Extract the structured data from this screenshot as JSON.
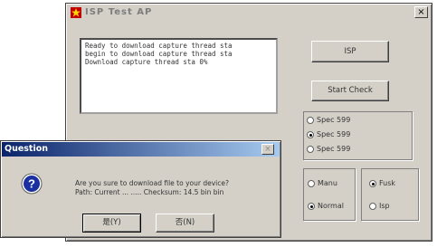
{
  "main_window": {
    "title": "ISP Test AP",
    "close_glyph": "×",
    "log_lines": [
      "Ready to download capture thread sta",
      "begin to download capture thread sta",
      "Download capture thread sta 0%"
    ],
    "buttons": {
      "top": "ISP",
      "second": "Start Check"
    },
    "spec_group": {
      "options": [
        {
          "label": "Spec 599",
          "checked": false
        },
        {
          "label": "Spec 599",
          "checked": true
        },
        {
          "label": "Spec 599",
          "checked": false
        }
      ]
    },
    "mode_group": {
      "left_options": [
        {
          "label": "Manu",
          "checked": false
        },
        {
          "label": "Normal",
          "checked": true
        }
      ],
      "right_options": [
        {
          "label": "Fusk",
          "checked": true
        },
        {
          "label": "Isp",
          "checked": false
        }
      ]
    }
  },
  "dialog": {
    "title": "Question",
    "close_glyph": "×",
    "icon": "question-icon",
    "message_lines": [
      "Are you sure to download file to your device?",
      "Path: Current ... ..... Checksum: 14.5 bin bin"
    ],
    "yes_label": "是(Y)",
    "no_label": "否(N)"
  },
  "colors": {
    "face": "#d4d0c8",
    "title_active_start": "#0a246a",
    "title_active_end": "#a6caf0",
    "title_icon": "#c00000"
  }
}
